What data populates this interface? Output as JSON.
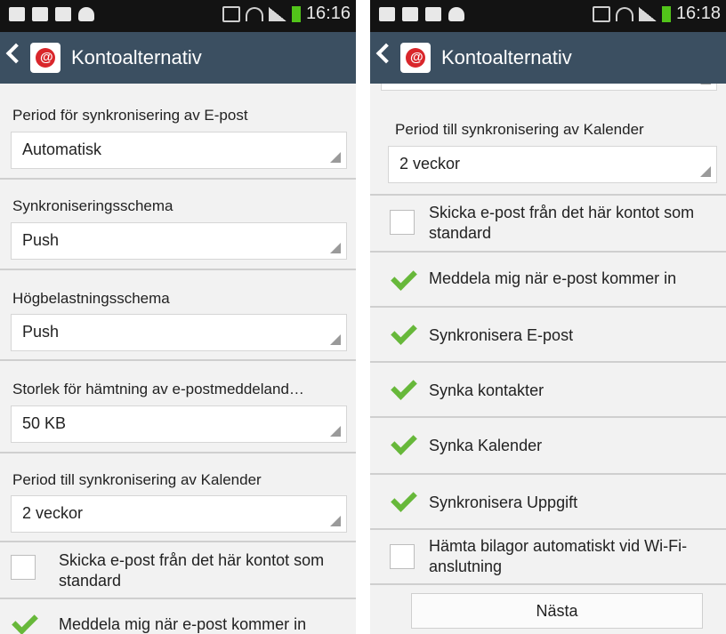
{
  "left": {
    "status": {
      "time": "16:16"
    },
    "header": {
      "title": "Kontoalternativ"
    },
    "spinners": [
      {
        "label": "Period för synkronisering av E-post",
        "value": "Automatisk"
      },
      {
        "label": "Synkroniseringsschema",
        "value": "Push"
      },
      {
        "label": "Högbelastningsschema",
        "value": "Push"
      },
      {
        "label": "Storlek för hämtning av e-postmeddeland…",
        "value": "50 KB"
      },
      {
        "label": "Period till synkronisering av Kalender",
        "value": "2 veckor"
      }
    ],
    "checkboxes": [
      {
        "label": "Skicka e-post från det här kontot som standard",
        "checked": false
      },
      {
        "label": "Meddela mig när e-post kommer in",
        "checked": true
      }
    ]
  },
  "right": {
    "status": {
      "time": "16:18"
    },
    "header": {
      "title": "Kontoalternativ"
    },
    "spinners": [
      {
        "label": "Period till synkronisering av Kalender",
        "value": "2 veckor"
      }
    ],
    "checkboxes": [
      {
        "label": "Skicka e-post från det här kontot som standard",
        "checked": false
      },
      {
        "label": "Meddela mig när e-post kommer in",
        "checked": true
      },
      {
        "label": "Synkronisera E-post",
        "checked": true
      },
      {
        "label": "Synka kontakter",
        "checked": true
      },
      {
        "label": "Synka Kalender",
        "checked": true
      },
      {
        "label": "Synkronisera Uppgift",
        "checked": true
      },
      {
        "label": "Hämta bilagor automatiskt vid Wi-Fi-anslutning",
        "checked": false
      }
    ],
    "next_button": "Nästa"
  },
  "colors": {
    "actionbar": "#3b4f61",
    "statusbar": "#131313",
    "checkmark": "#67b83a",
    "background": "#f2f2f2"
  },
  "icons": [
    "back-arrow-icon",
    "email-app-icon",
    "screenshot-icon",
    "gallery-icon",
    "email-notification-icon",
    "cloud-icon",
    "mute-icon",
    "wifi-icon",
    "signal-icon",
    "battery-icon"
  ]
}
